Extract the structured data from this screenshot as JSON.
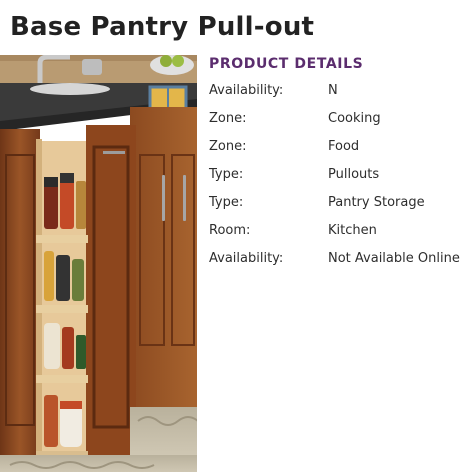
{
  "page": {
    "title": "Base Pantry Pull-out"
  },
  "image": {
    "alt": "Base pantry pull-out cabinet with spice jars"
  },
  "details": {
    "heading": "PRODUCT DETAILS",
    "rows": [
      {
        "label": "Availability:",
        "value": "N"
      },
      {
        "label": "Zone:",
        "value": "Cooking"
      },
      {
        "label": "Zone:",
        "value": "Food"
      },
      {
        "label": "Type:",
        "value": "Pullouts"
      },
      {
        "label": "Type:",
        "value": "Pantry Storage"
      },
      {
        "label": "Room:",
        "value": "Kitchen"
      },
      {
        "label": "Availability:",
        "value": "Not Available Online"
      }
    ]
  },
  "colors": {
    "heading_accent": "#5b2d6e",
    "cabinet_wood": "#8a4a22",
    "countertop": "#3a3a3a"
  }
}
